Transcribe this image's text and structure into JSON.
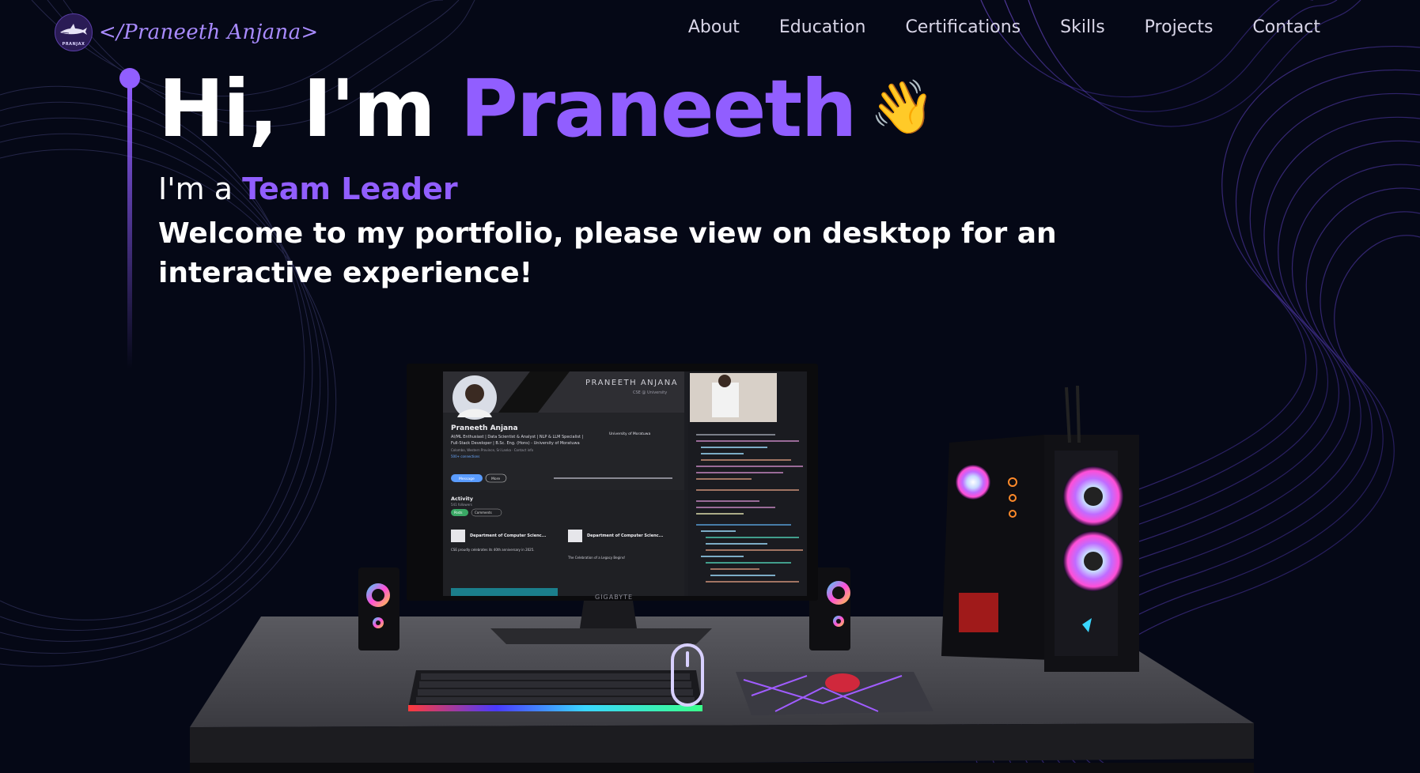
{
  "nav": {
    "logo_text": "PRANJAX",
    "brand": "</Praneeth Anjana>",
    "links": [
      "About",
      "Education",
      "Certifications",
      "Skills",
      "Projects",
      "Contact"
    ]
  },
  "hero": {
    "greeting": "Hi, I'm ",
    "name": "Praneeth",
    "emoji": "👋",
    "role_prefix": "I'm a ",
    "role": "Team Leader",
    "welcome": "Welcome to my portfolio, please view on desktop for an interactive experience!"
  },
  "scene": {
    "profile_banner_name": "PRANEETH ANJANA",
    "profile_banner_sub": "CSE @ University",
    "profile_name": "Praneeth Anjana",
    "profile_headline": "AI/ML Enthusiast | Data Scientist & Analyst | NLP & LLM Specialist |",
    "profile_headline2": "Full-Stack Developer | B.Sc. Eng. (Hons) - University of Moratuwa",
    "profile_location": "Colombo, Western Province, Sri Lanka · Contact info",
    "profile_connections": "500+ connections",
    "profile_university": "University of Moratuwa",
    "btn_message": "Message",
    "btn_more": "More",
    "activity_title": "Activity",
    "activity_followers": "541 followers",
    "tab_posts": "Posts",
    "tab_comments": "Comments",
    "post1_title": "Department of Computer Scienc...",
    "post2_title": "Department of Computer Scienc...",
    "post1_text": "CSE proudly celebrates its 40th anniversary in 2025.",
    "post2_text": "The Celebration of a Legacy Begins!",
    "monitor_brand": "GIGABYTE"
  },
  "colors": {
    "accent": "#915EFF",
    "background": "#050816"
  },
  "icons": {
    "logo": "shark-logo-icon",
    "emoji": "waving-hand-icon"
  }
}
